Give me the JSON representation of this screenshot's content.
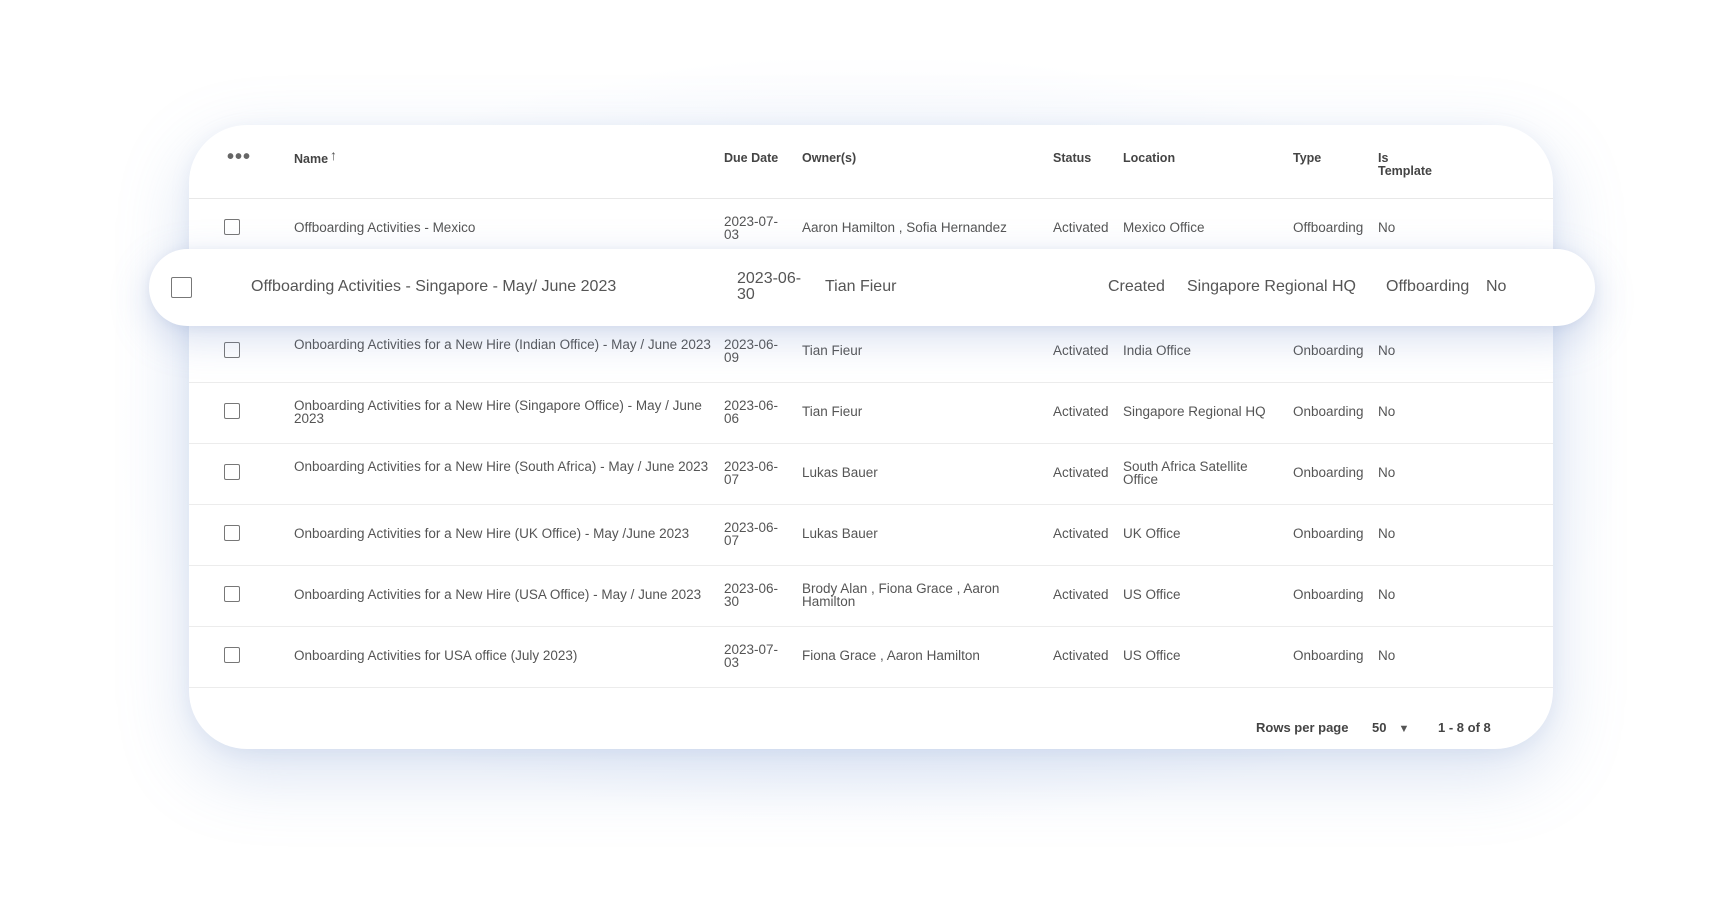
{
  "table": {
    "columns": {
      "name": "Name",
      "due": "Due Date",
      "owners": "Owner(s)",
      "status": "Status",
      "location": "Location",
      "type": "Type",
      "template": "Is Template"
    },
    "rows": [
      {
        "name": "Offboarding Activities - Mexico",
        "due": "2023-07-03",
        "owners": "Aaron Hamilton , Sofia Hernandez",
        "status": "Activated",
        "location": "Mexico Office",
        "type": "Offboarding",
        "template": "No"
      },
      {
        "name": "Offboarding Activities - Singapore - May/ June 2023",
        "due": "2023-06-30",
        "owners": "Tian Fieur",
        "status": "Created",
        "location": "Singapore Regional HQ",
        "type": "Offboarding",
        "template": "No"
      },
      {
        "name": "Onboarding Activities for a New Hire (Indian Office) - May / June 2023",
        "due": "2023-06-09",
        "owners": "Tian Fieur",
        "status": "Activated",
        "location": "India Office",
        "type": "Onboarding",
        "template": "No"
      },
      {
        "name": "Onboarding Activities for a New Hire (Singapore Office) - May / June 2023",
        "due": "2023-06-06",
        "owners": "Tian Fieur",
        "status": "Activated",
        "location": "Singapore Regional HQ",
        "type": "Onboarding",
        "template": "No"
      },
      {
        "name": "Onboarding Activities for a New Hire (South Africa) - May / June 2023",
        "due": "2023-06-07",
        "owners": "Lukas Bauer",
        "status": "Activated",
        "location": "South Africa Satellite Office",
        "type": "Onboarding",
        "template": "No"
      },
      {
        "name": "Onboarding Activities for a New Hire (UK Office) - May /June 2023",
        "due": "2023-06-07",
        "owners": "Lukas Bauer",
        "status": "Activated",
        "location": "UK Office",
        "type": "Onboarding",
        "template": "No"
      },
      {
        "name": "Onboarding Activities for a New Hire (USA Office) - May / June 2023",
        "due": "2023-06-30",
        "owners": "Brody Alan , Fiona Grace , Aaron Hamilton",
        "status": "Activated",
        "location": "US Office",
        "type": "Onboarding",
        "template": "No"
      },
      {
        "name": "Onboarding Activities for USA office (July 2023)",
        "due": "2023-07-03",
        "owners": "Fiona Grace , Aaron Hamilton",
        "status": "Activated",
        "location": "US Office",
        "type": "Onboarding",
        "template": "No"
      }
    ]
  },
  "icons": {
    "menu": "more-horizontal-icon",
    "sort": "arrow-up-icon",
    "caret": "caret-down-icon"
  },
  "menu_glyph": "•••",
  "sort_glyph": "↑",
  "caret_glyph": "▼",
  "footer": {
    "rows_per_page_label": "Rows per page",
    "rows_per_page_value": "50",
    "range": "1 - 8 of 8"
  }
}
